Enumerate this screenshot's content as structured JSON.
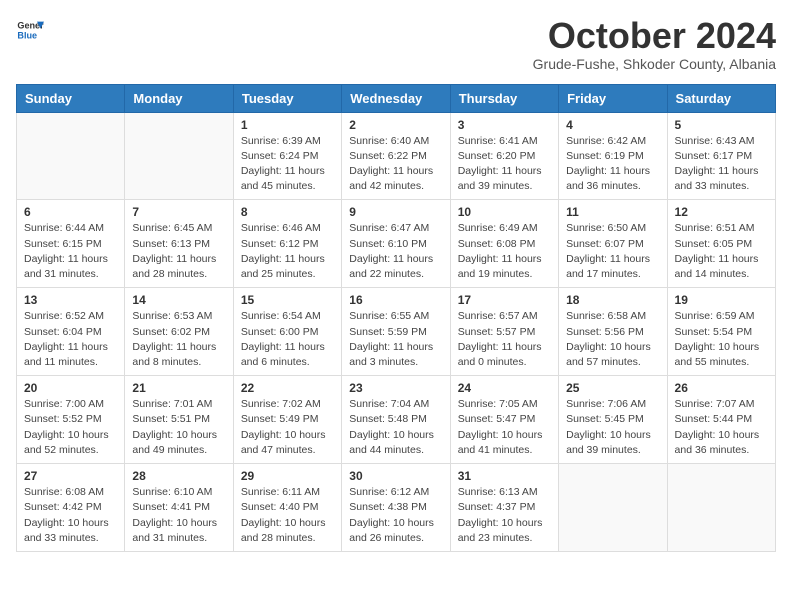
{
  "header": {
    "logo_general": "General",
    "logo_blue": "Blue",
    "month_title": "October 2024",
    "subtitle": "Grude-Fushe, Shkoder County, Albania"
  },
  "weekdays": [
    "Sunday",
    "Monday",
    "Tuesday",
    "Wednesday",
    "Thursday",
    "Friday",
    "Saturday"
  ],
  "weeks": [
    [
      {
        "day": "",
        "info": ""
      },
      {
        "day": "",
        "info": ""
      },
      {
        "day": "1",
        "info": "Sunrise: 6:39 AM\nSunset: 6:24 PM\nDaylight: 11 hours and 45 minutes."
      },
      {
        "day": "2",
        "info": "Sunrise: 6:40 AM\nSunset: 6:22 PM\nDaylight: 11 hours and 42 minutes."
      },
      {
        "day": "3",
        "info": "Sunrise: 6:41 AM\nSunset: 6:20 PM\nDaylight: 11 hours and 39 minutes."
      },
      {
        "day": "4",
        "info": "Sunrise: 6:42 AM\nSunset: 6:19 PM\nDaylight: 11 hours and 36 minutes."
      },
      {
        "day": "5",
        "info": "Sunrise: 6:43 AM\nSunset: 6:17 PM\nDaylight: 11 hours and 33 minutes."
      }
    ],
    [
      {
        "day": "6",
        "info": "Sunrise: 6:44 AM\nSunset: 6:15 PM\nDaylight: 11 hours and 31 minutes."
      },
      {
        "day": "7",
        "info": "Sunrise: 6:45 AM\nSunset: 6:13 PM\nDaylight: 11 hours and 28 minutes."
      },
      {
        "day": "8",
        "info": "Sunrise: 6:46 AM\nSunset: 6:12 PM\nDaylight: 11 hours and 25 minutes."
      },
      {
        "day": "9",
        "info": "Sunrise: 6:47 AM\nSunset: 6:10 PM\nDaylight: 11 hours and 22 minutes."
      },
      {
        "day": "10",
        "info": "Sunrise: 6:49 AM\nSunset: 6:08 PM\nDaylight: 11 hours and 19 minutes."
      },
      {
        "day": "11",
        "info": "Sunrise: 6:50 AM\nSunset: 6:07 PM\nDaylight: 11 hours and 17 minutes."
      },
      {
        "day": "12",
        "info": "Sunrise: 6:51 AM\nSunset: 6:05 PM\nDaylight: 11 hours and 14 minutes."
      }
    ],
    [
      {
        "day": "13",
        "info": "Sunrise: 6:52 AM\nSunset: 6:04 PM\nDaylight: 11 hours and 11 minutes."
      },
      {
        "day": "14",
        "info": "Sunrise: 6:53 AM\nSunset: 6:02 PM\nDaylight: 11 hours and 8 minutes."
      },
      {
        "day": "15",
        "info": "Sunrise: 6:54 AM\nSunset: 6:00 PM\nDaylight: 11 hours and 6 minutes."
      },
      {
        "day": "16",
        "info": "Sunrise: 6:55 AM\nSunset: 5:59 PM\nDaylight: 11 hours and 3 minutes."
      },
      {
        "day": "17",
        "info": "Sunrise: 6:57 AM\nSunset: 5:57 PM\nDaylight: 11 hours and 0 minutes."
      },
      {
        "day": "18",
        "info": "Sunrise: 6:58 AM\nSunset: 5:56 PM\nDaylight: 10 hours and 57 minutes."
      },
      {
        "day": "19",
        "info": "Sunrise: 6:59 AM\nSunset: 5:54 PM\nDaylight: 10 hours and 55 minutes."
      }
    ],
    [
      {
        "day": "20",
        "info": "Sunrise: 7:00 AM\nSunset: 5:52 PM\nDaylight: 10 hours and 52 minutes."
      },
      {
        "day": "21",
        "info": "Sunrise: 7:01 AM\nSunset: 5:51 PM\nDaylight: 10 hours and 49 minutes."
      },
      {
        "day": "22",
        "info": "Sunrise: 7:02 AM\nSunset: 5:49 PM\nDaylight: 10 hours and 47 minutes."
      },
      {
        "day": "23",
        "info": "Sunrise: 7:04 AM\nSunset: 5:48 PM\nDaylight: 10 hours and 44 minutes."
      },
      {
        "day": "24",
        "info": "Sunrise: 7:05 AM\nSunset: 5:47 PM\nDaylight: 10 hours and 41 minutes."
      },
      {
        "day": "25",
        "info": "Sunrise: 7:06 AM\nSunset: 5:45 PM\nDaylight: 10 hours and 39 minutes."
      },
      {
        "day": "26",
        "info": "Sunrise: 7:07 AM\nSunset: 5:44 PM\nDaylight: 10 hours and 36 minutes."
      }
    ],
    [
      {
        "day": "27",
        "info": "Sunrise: 6:08 AM\nSunset: 4:42 PM\nDaylight: 10 hours and 33 minutes."
      },
      {
        "day": "28",
        "info": "Sunrise: 6:10 AM\nSunset: 4:41 PM\nDaylight: 10 hours and 31 minutes."
      },
      {
        "day": "29",
        "info": "Sunrise: 6:11 AM\nSunset: 4:40 PM\nDaylight: 10 hours and 28 minutes."
      },
      {
        "day": "30",
        "info": "Sunrise: 6:12 AM\nSunset: 4:38 PM\nDaylight: 10 hours and 26 minutes."
      },
      {
        "day": "31",
        "info": "Sunrise: 6:13 AM\nSunset: 4:37 PM\nDaylight: 10 hours and 23 minutes."
      },
      {
        "day": "",
        "info": ""
      },
      {
        "day": "",
        "info": ""
      }
    ]
  ]
}
